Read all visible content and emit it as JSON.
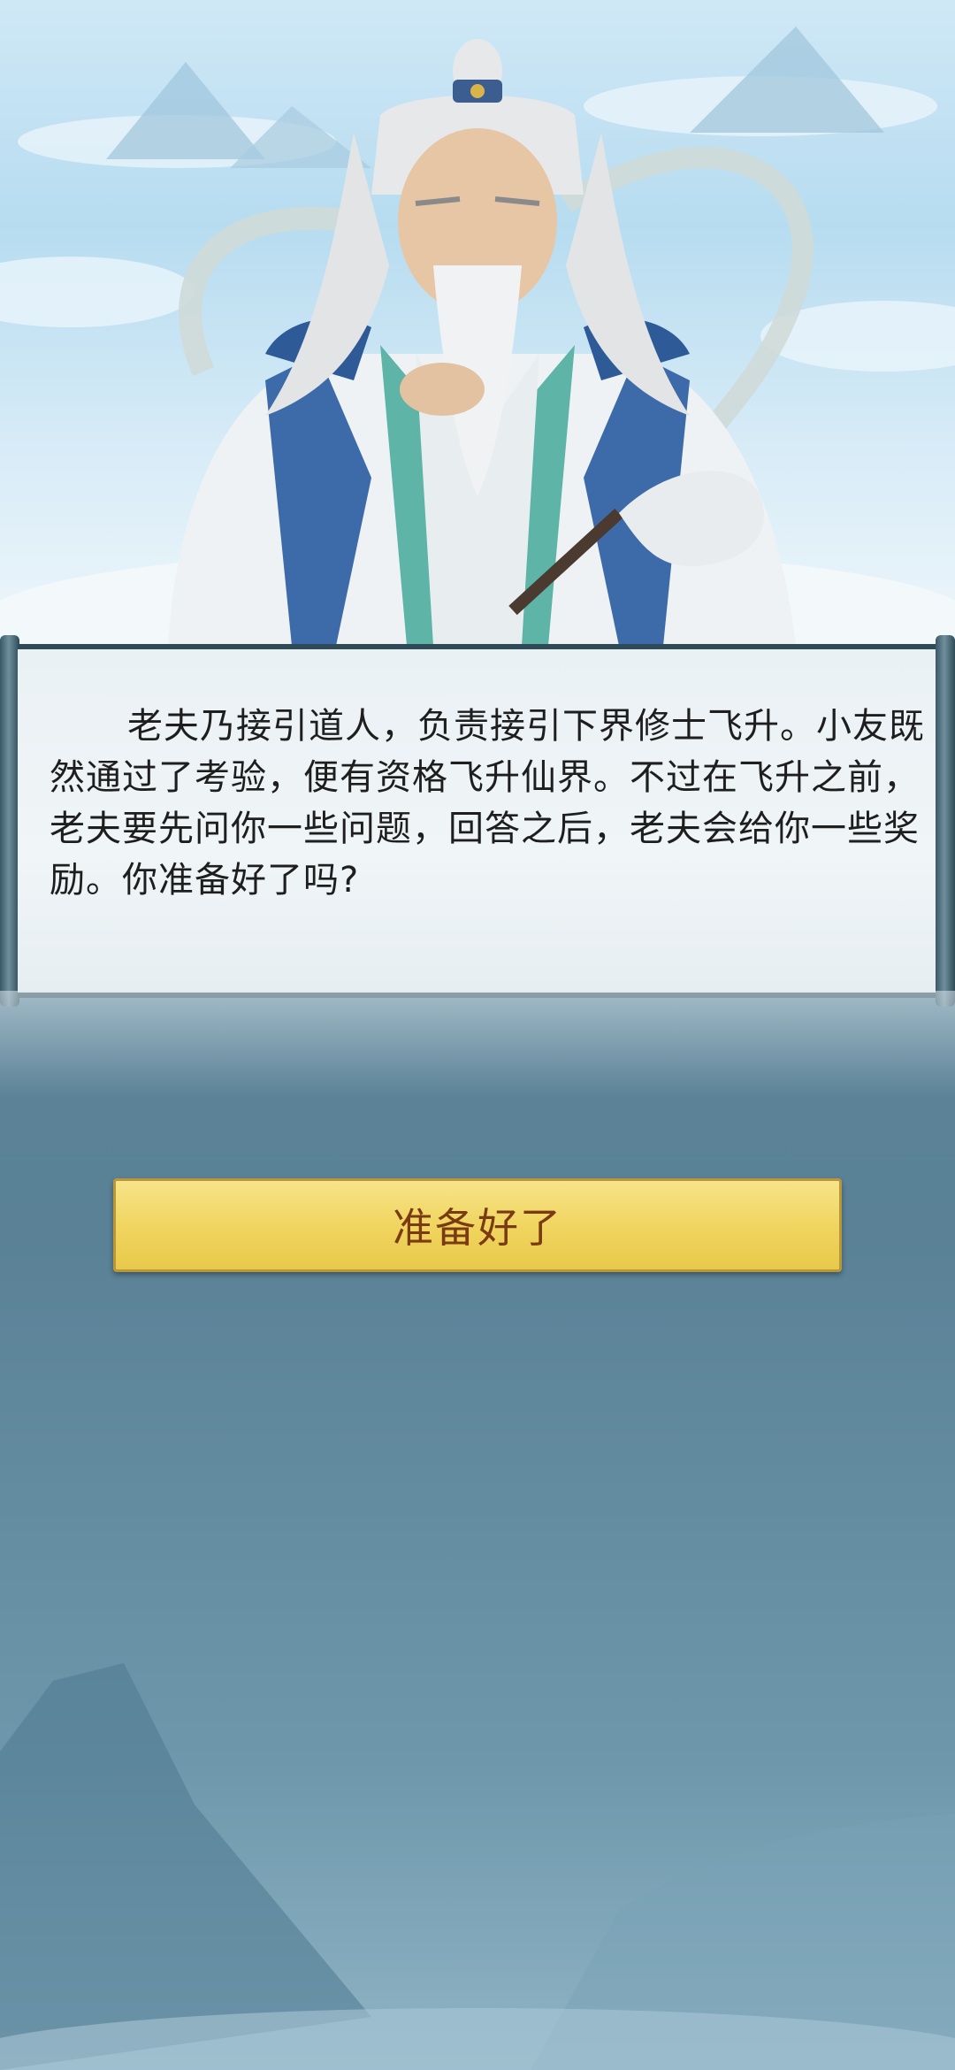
{
  "dialog": {
    "text": "老夫乃接引道人，负责接引下界修士飞升。小友既然通过了考验，便有资格飞升仙界。不过在飞升之前，老夫要先问你一些问题，回答之后，老夫会给你一些奖励。你准备好了吗?"
  },
  "actions": {
    "ready_label": "准备好了"
  },
  "colors": {
    "button_fill": "#f0d560",
    "button_text": "#7a3b12",
    "panel_border": "#2f4b58"
  }
}
